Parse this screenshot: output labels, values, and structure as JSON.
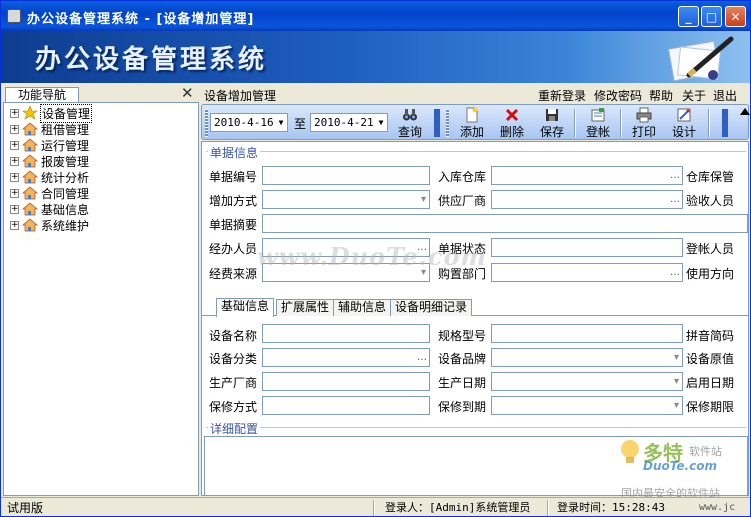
{
  "window": {
    "title": "办公设备管理系统 - [设备增加管理]",
    "banner_title": "办公设备管理系统",
    "minimize": "_",
    "maximize": "□",
    "close": "✕"
  },
  "nav": {
    "header": "功能导航",
    "close": "✕",
    "items": [
      {
        "label": "设备管理",
        "icon": "star-icon",
        "selected": true
      },
      {
        "label": "租借管理",
        "icon": "house-icon"
      },
      {
        "label": "运行管理",
        "icon": "house-icon"
      },
      {
        "label": "报废管理",
        "icon": "house-icon"
      },
      {
        "label": "统计分析",
        "icon": "house-icon"
      },
      {
        "label": "合同管理",
        "icon": "house-icon"
      },
      {
        "label": "基础信息",
        "icon": "house-icon"
      },
      {
        "label": "系统维护",
        "icon": "house-icon"
      }
    ]
  },
  "breadcrumb": "设备增加管理",
  "menu": {
    "relogin": "重新登录",
    "change_password": "修改密码",
    "help": "帮助",
    "about": "关于",
    "exit": "退出"
  },
  "toolbar": {
    "date_from": "2010-4-16",
    "to_label": "至",
    "date_to": "2010-4-21",
    "query": "查询",
    "add": "添加",
    "delete": "删除",
    "save": "保存",
    "post": "登帐",
    "print": "打印",
    "design": "设计"
  },
  "form": {
    "group_doc": "单据信息",
    "doc_no": "单据编号",
    "warehouse": "入库仓库",
    "warehouse_keeper": "仓库保管",
    "add_method": "增加方式",
    "supplier": "供应厂商",
    "inspector": "验收人员",
    "summary": "单据摘要",
    "handler": "经办人员",
    "doc_status": "单据状态",
    "poster": "登帐人员",
    "fund_source": "经费来源",
    "purchase_dept": "购置部门",
    "use_direction": "使用方向"
  },
  "tabs": [
    "基础信息",
    "扩展属性",
    "辅助信息",
    "设备明细记录"
  ],
  "basic": {
    "device_name": "设备名称",
    "model": "规格型号",
    "pinyin": "拼音简码",
    "category": "设备分类",
    "brand": "设备品牌",
    "original_value": "设备原值",
    "manufacturer": "生产厂商",
    "production_date": "生产日期",
    "start_date": "启用日期",
    "warranty_method": "保修方式",
    "warranty_expiry": "保修到期",
    "warranty_period": "保修期限",
    "detail_config": "详细配置"
  },
  "watermark": "www.DuoTe.com",
  "brand_logo": {
    "cn": "多特",
    "sub": "软件站",
    "en": "DuoTe.com",
    "slogan": "国内最安全的软件站",
    "url": "www.jc"
  },
  "status": {
    "edition": "试用版",
    "login_user": "登录人：[Admin]系统管理员",
    "login_time": "登录时间：15:28:43"
  },
  "colors": {
    "titlebar": "#0143c9",
    "banner": "#1e5dbf",
    "toolbar": "#a8c6f2",
    "border": "#7f9db9"
  }
}
